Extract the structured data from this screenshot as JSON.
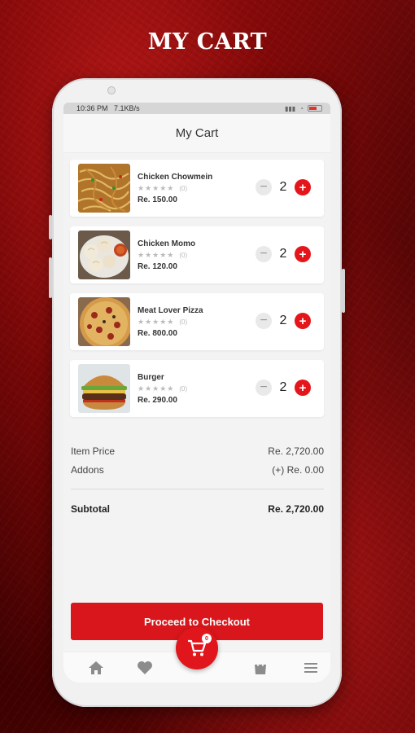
{
  "headline": "MY CART",
  "status_bar": {
    "time": "10:36 PM",
    "speed": "7.1KB/s"
  },
  "appbar": {
    "title": "My Cart"
  },
  "items": [
    {
      "name": "Chicken Chowmein",
      "stars": "★★★★★",
      "rating_count": "(0)",
      "price": "Re. 150.00",
      "qty": "2"
    },
    {
      "name": "Chicken Momo",
      "stars": "★★★★★",
      "rating_count": "(0)",
      "price": "Re. 120.00",
      "qty": "2"
    },
    {
      "name": "Meat Lover Pizza",
      "stars": "★★★★★",
      "rating_count": "(0)",
      "price": "Re. 800.00",
      "qty": "2"
    },
    {
      "name": "Burger",
      "stars": "★★★★★",
      "rating_count": "(0)",
      "price": "Re. 290.00",
      "qty": "2"
    }
  ],
  "stepper": {
    "minus": "−",
    "plus": "+"
  },
  "summary": {
    "item_price_label": "Item Price",
    "item_price_value": "Re. 2,720.00",
    "addons_label": "Addons",
    "addons_value": "(+) Re. 0.00",
    "subtotal_label": "Subtotal",
    "subtotal_value": "Re. 2,720.00"
  },
  "checkout_label": "Proceed to Checkout",
  "cart_badge": "0",
  "colors": {
    "accent": "#d8161b",
    "background": "#6e0a0a"
  },
  "icons": [
    "home-icon",
    "heart-icon",
    "cart-icon",
    "bag-icon",
    "menu-icon"
  ]
}
